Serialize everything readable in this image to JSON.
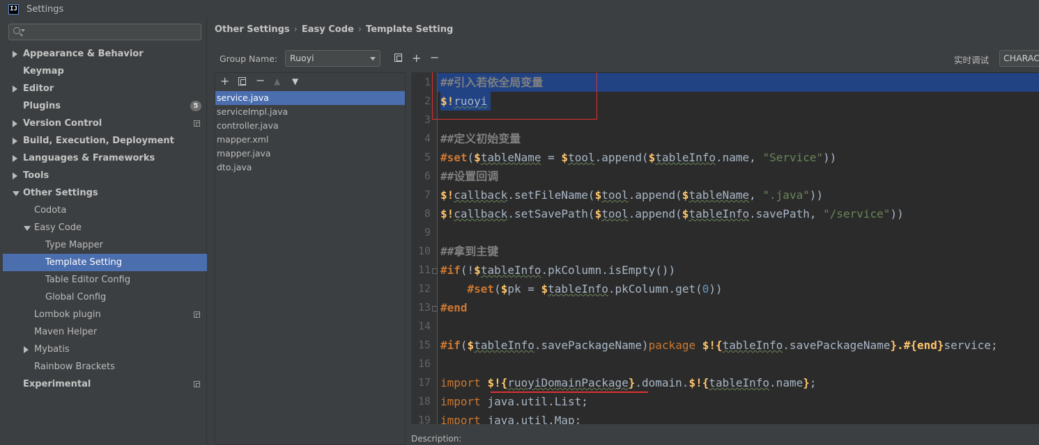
{
  "window": {
    "title": "Settings",
    "app_icon_text": "IJ"
  },
  "search": {
    "placeholder": ""
  },
  "tree": [
    {
      "label": "Appearance & Behavior",
      "level": 0,
      "bold": true,
      "arrow": "right"
    },
    {
      "label": "Keymap",
      "level": 0,
      "bold": true,
      "arrow": ""
    },
    {
      "label": "Editor",
      "level": 0,
      "bold": true,
      "arrow": "right"
    },
    {
      "label": "Plugins",
      "level": 0,
      "bold": true,
      "arrow": "",
      "badge": "5"
    },
    {
      "label": "Version Control",
      "level": 0,
      "bold": true,
      "arrow": "right",
      "copy": true
    },
    {
      "label": "Build, Execution, Deployment",
      "level": 0,
      "bold": true,
      "arrow": "right"
    },
    {
      "label": "Languages & Frameworks",
      "level": 0,
      "bold": true,
      "arrow": "right"
    },
    {
      "label": "Tools",
      "level": 0,
      "bold": true,
      "arrow": "right"
    },
    {
      "label": "Other Settings",
      "level": 0,
      "bold": true,
      "arrow": "down"
    },
    {
      "label": "Codota",
      "level": 1,
      "bold": false,
      "arrow": ""
    },
    {
      "label": "Easy Code",
      "level": 1,
      "bold": false,
      "arrow": "down"
    },
    {
      "label": "Type Mapper",
      "level": 2,
      "bold": false,
      "arrow": ""
    },
    {
      "label": "Template Setting",
      "level": 2,
      "bold": false,
      "arrow": "",
      "selected": true
    },
    {
      "label": "Table Editor Config",
      "level": 2,
      "bold": false,
      "arrow": ""
    },
    {
      "label": "Global Config",
      "level": 2,
      "bold": false,
      "arrow": ""
    },
    {
      "label": "Lombok plugin",
      "level": 1,
      "bold": false,
      "arrow": "",
      "copy": true
    },
    {
      "label": "Maven Helper",
      "level": 1,
      "bold": false,
      "arrow": ""
    },
    {
      "label": "Mybatis",
      "level": 1,
      "bold": false,
      "arrow": "right"
    },
    {
      "label": "Rainbow Brackets",
      "level": 1,
      "bold": false,
      "arrow": ""
    },
    {
      "label": "Experimental",
      "level": 0,
      "bold": true,
      "arrow": "",
      "copy": true
    }
  ],
  "breadcrumb": [
    "Other Settings",
    "Easy Code",
    "Template Setting"
  ],
  "group": {
    "label": "Group Name:",
    "value": "Ruoyi"
  },
  "debug": {
    "label": "实时调试",
    "value": "CHARACTER"
  },
  "files": [
    {
      "name": "service.java",
      "selected": true
    },
    {
      "name": "serviceImpl.java"
    },
    {
      "name": "controller.java"
    },
    {
      "name": "mapper.xml"
    },
    {
      "name": "mapper.java"
    },
    {
      "name": "dto.java"
    }
  ],
  "code_lines": [
    [
      [
        "c-comment",
        "##引入若依全局变量"
      ]
    ],
    [
      [
        "c-var",
        "$!"
      ],
      [
        "c-id",
        "ruoyi"
      ]
    ],
    [],
    [
      [
        "c-comment",
        "##定义初始变量"
      ]
    ],
    [
      [
        "c-kw",
        "#set"
      ],
      [
        "",
        "("
      ],
      [
        "c-var",
        "$"
      ],
      [
        "c-id",
        "tableName"
      ],
      [
        "",
        " = "
      ],
      [
        "c-var",
        "$"
      ],
      [
        "c-id",
        "tool"
      ],
      [
        "",
        ".append("
      ],
      [
        "c-var",
        "$"
      ],
      [
        "c-id",
        "tableInfo"
      ],
      [
        "",
        ".name, "
      ],
      [
        "c-str",
        "\"Service\""
      ],
      [
        "",
        "))"
      ]
    ],
    [
      [
        "c-comment",
        "##设置回调"
      ]
    ],
    [
      [
        "c-var",
        "$!"
      ],
      [
        "c-id",
        "callback"
      ],
      [
        "",
        ".setFileName("
      ],
      [
        "c-var",
        "$"
      ],
      [
        "c-id",
        "tool"
      ],
      [
        "",
        ".append("
      ],
      [
        "c-var",
        "$"
      ],
      [
        "c-id",
        "tableName"
      ],
      [
        "",
        ", "
      ],
      [
        "c-str",
        "\".java\""
      ],
      [
        "",
        "))"
      ]
    ],
    [
      [
        "c-var",
        "$!"
      ],
      [
        "c-id",
        "callback"
      ],
      [
        "",
        ".setSavePath("
      ],
      [
        "c-var",
        "$"
      ],
      [
        "c-id",
        "tool"
      ],
      [
        "",
        ".append("
      ],
      [
        "c-var",
        "$"
      ],
      [
        "c-id",
        "tableInfo"
      ],
      [
        "",
        ".savePath, "
      ],
      [
        "c-str",
        "\"/service\""
      ],
      [
        "",
        "))"
      ]
    ],
    [],
    [
      [
        "c-comment",
        "##拿到主键"
      ]
    ],
    [
      [
        "c-kw",
        "#if"
      ],
      [
        "",
        "(!"
      ],
      [
        "c-var",
        "$"
      ],
      [
        "c-id",
        "tableInfo"
      ],
      [
        "",
        ".pkColumn.isEmpty())"
      ]
    ],
    [
      [
        "",
        "    "
      ],
      [
        "c-kw",
        "#set"
      ],
      [
        "",
        "("
      ],
      [
        "c-var",
        "$"
      ],
      [
        "",
        "pk = "
      ],
      [
        "c-var",
        "$"
      ],
      [
        "c-id",
        "tableInfo"
      ],
      [
        "",
        ".pkColumn.get("
      ],
      [
        "c-num",
        "0"
      ],
      [
        "",
        "))"
      ]
    ],
    [
      [
        "c-kw",
        "#end"
      ]
    ],
    [],
    [
      [
        "c-kw",
        "#if"
      ],
      [
        "",
        "("
      ],
      [
        "c-var",
        "$"
      ],
      [
        "c-id",
        "tableInfo"
      ],
      [
        "",
        ".savePackageName)"
      ],
      [
        "c-pkg",
        "package "
      ],
      [
        "c-var",
        "$!{"
      ],
      [
        "c-id",
        "tableInfo"
      ],
      [
        "",
        ".savePackageName"
      ],
      [
        "c-var",
        "}.#{end}"
      ],
      [
        "",
        "service;"
      ]
    ],
    [],
    [
      [
        "c-pkg",
        "import "
      ],
      [
        "c-var",
        "$!{"
      ],
      [
        "c-id",
        "ruoyiDomainPackage"
      ],
      [
        "c-var",
        "}"
      ],
      [
        "",
        ".domain."
      ],
      [
        "c-var",
        "$!{"
      ],
      [
        "c-id",
        "tableInfo"
      ],
      [
        "",
        ".name"
      ],
      [
        "c-var",
        "}"
      ],
      [
        "",
        ";"
      ]
    ],
    [
      [
        "c-pkg",
        "import "
      ],
      [
        "",
        "java.util.List;"
      ]
    ],
    [
      [
        "c-pkg",
        "import "
      ],
      [
        "",
        "java.util.Map;"
      ]
    ]
  ],
  "line_numbers": [
    "1",
    "2",
    "3",
    "4",
    "5",
    "6",
    "7",
    "8",
    "9",
    "10",
    "11",
    "12",
    "13",
    "14",
    "15",
    "16",
    "17",
    "18",
    "19"
  ],
  "description": {
    "label": "Description:"
  },
  "colors": {
    "selection": "#4b6eaf",
    "editor_bg": "#2b2b2b",
    "highlight": "#214283",
    "annotation": "#e03030"
  }
}
